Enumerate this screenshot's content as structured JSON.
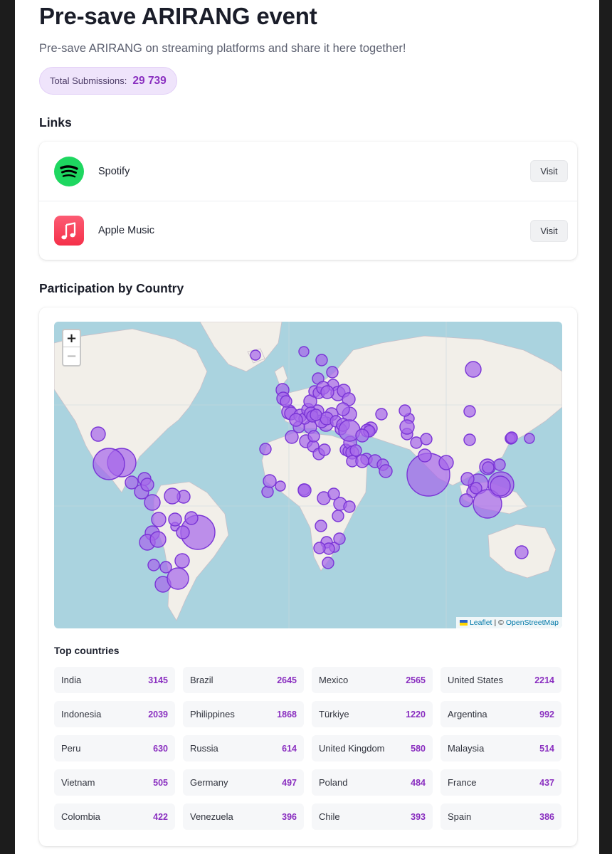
{
  "header": {
    "title": "Pre-save ARIRANG event",
    "subtitle": "Pre-save ARIRANG on streaming platforms and share it here together!",
    "total_label": "Total Submissions:",
    "total_value": "29 739"
  },
  "links": {
    "title": "Links",
    "items": [
      {
        "name": "Spotify",
        "icon": "spotify-icon",
        "button": "Visit"
      },
      {
        "name": "Apple Music",
        "icon": "apple-music-icon",
        "button": "Visit"
      }
    ]
  },
  "participation": {
    "title": "Participation by Country",
    "map": {
      "zoom_in": "+",
      "zoom_out": "−",
      "attribution_leaflet": "Leaflet",
      "attribution_sep": "| ©",
      "attribution_osm": "OpenStreetMap"
    },
    "top_title": "Top countries",
    "countries": [
      {
        "name": "India",
        "count": "3145"
      },
      {
        "name": "Brazil",
        "count": "2645"
      },
      {
        "name": "Mexico",
        "count": "2565"
      },
      {
        "name": "United States",
        "count": "2214"
      },
      {
        "name": "Indonesia",
        "count": "2039"
      },
      {
        "name": "Philippines",
        "count": "1868"
      },
      {
        "name": "Türkiye",
        "count": "1220"
      },
      {
        "name": "Argentina",
        "count": "992"
      },
      {
        "name": "Peru",
        "count": "630"
      },
      {
        "name": "Russia",
        "count": "614"
      },
      {
        "name": "United Kingdom",
        "count": "580"
      },
      {
        "name": "Malaysia",
        "count": "514"
      },
      {
        "name": "Vietnam",
        "count": "505"
      },
      {
        "name": "Germany",
        "count": "497"
      },
      {
        "name": "Poland",
        "count": "484"
      },
      {
        "name": "France",
        "count": "437"
      },
      {
        "name": "Colombia",
        "count": "422"
      },
      {
        "name": "Venezuela",
        "count": "396"
      },
      {
        "name": "Chile",
        "count": "393"
      },
      {
        "name": "Spain",
        "count": "386"
      }
    ]
  },
  "colors": {
    "accent": "#8a2fc0",
    "marker_fill": "#a668ea",
    "marker_stroke": "#7a35d6",
    "spotify": "#1ed760",
    "apple_music": "#fa3c55",
    "water": "#aad3df",
    "land": "#f2efe9"
  }
}
